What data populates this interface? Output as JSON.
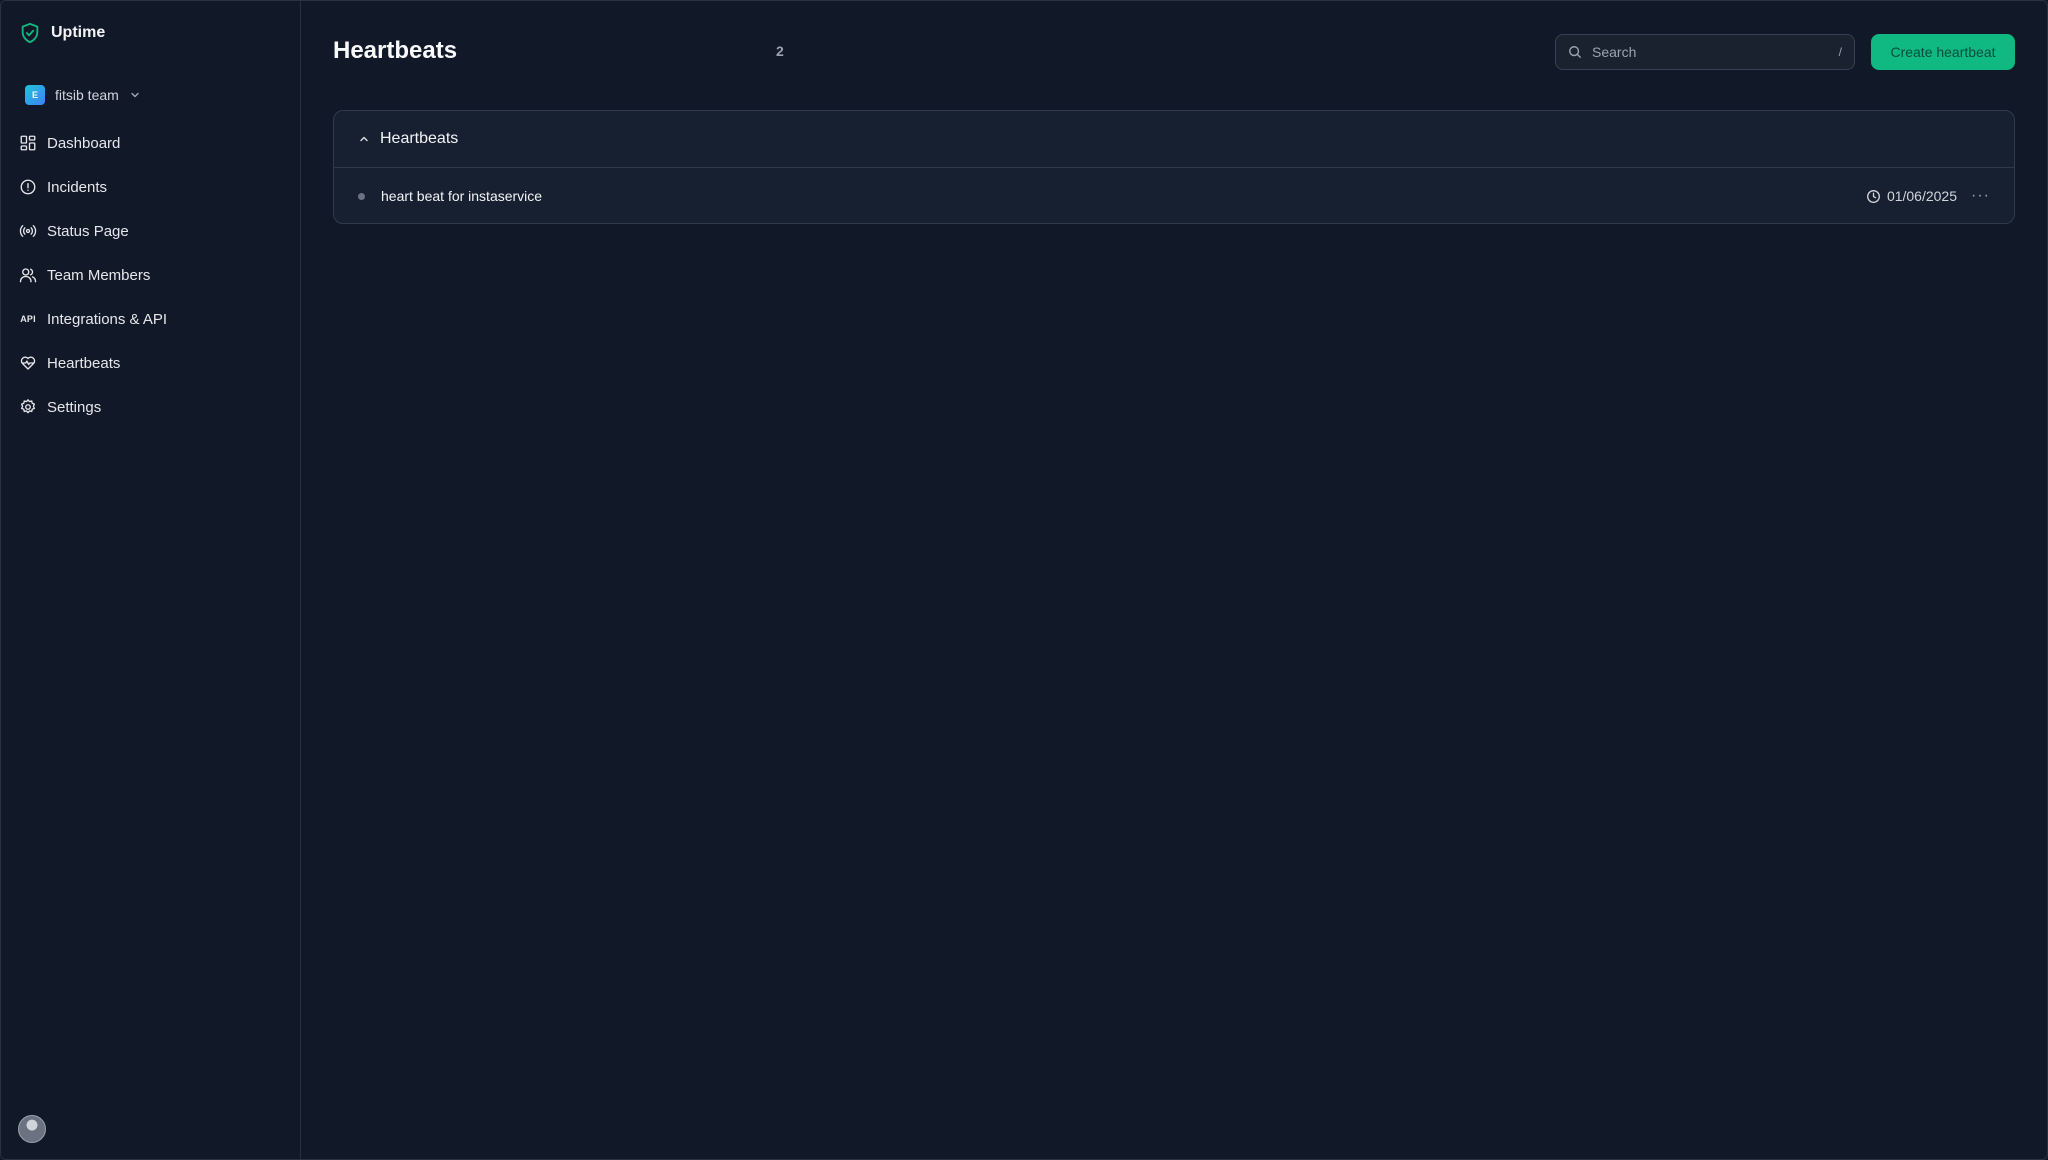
{
  "app": {
    "name": "Uptime"
  },
  "team": {
    "name": "fitsib team",
    "logo_text": "E"
  },
  "sidebar": {
    "items": [
      {
        "label": "Dashboard",
        "icon": "dashboard-icon"
      },
      {
        "label": "Incidents",
        "icon": "alert-circle-icon"
      },
      {
        "label": "Status Page",
        "icon": "broadcast-icon"
      },
      {
        "label": "Team Members",
        "icon": "users-icon"
      },
      {
        "label": "Integrations & API",
        "icon": "api-icon",
        "icon_text": "API"
      },
      {
        "label": "Heartbeats",
        "icon": "heart-pulse-icon"
      },
      {
        "label": "Settings",
        "icon": "gear-icon"
      }
    ]
  },
  "header": {
    "title": "Heartbeats",
    "count": "2"
  },
  "search": {
    "placeholder": "Search",
    "shortcut": "/"
  },
  "actions": {
    "create_label": "Create heartbeat"
  },
  "panel": {
    "title": "Heartbeats",
    "rows": [
      {
        "name": "heart beat for instaservice",
        "date": "01/06/2025",
        "more": "···"
      }
    ]
  },
  "colors": {
    "accent": "#10b981",
    "background": "#111827",
    "panel": "#162031"
  }
}
